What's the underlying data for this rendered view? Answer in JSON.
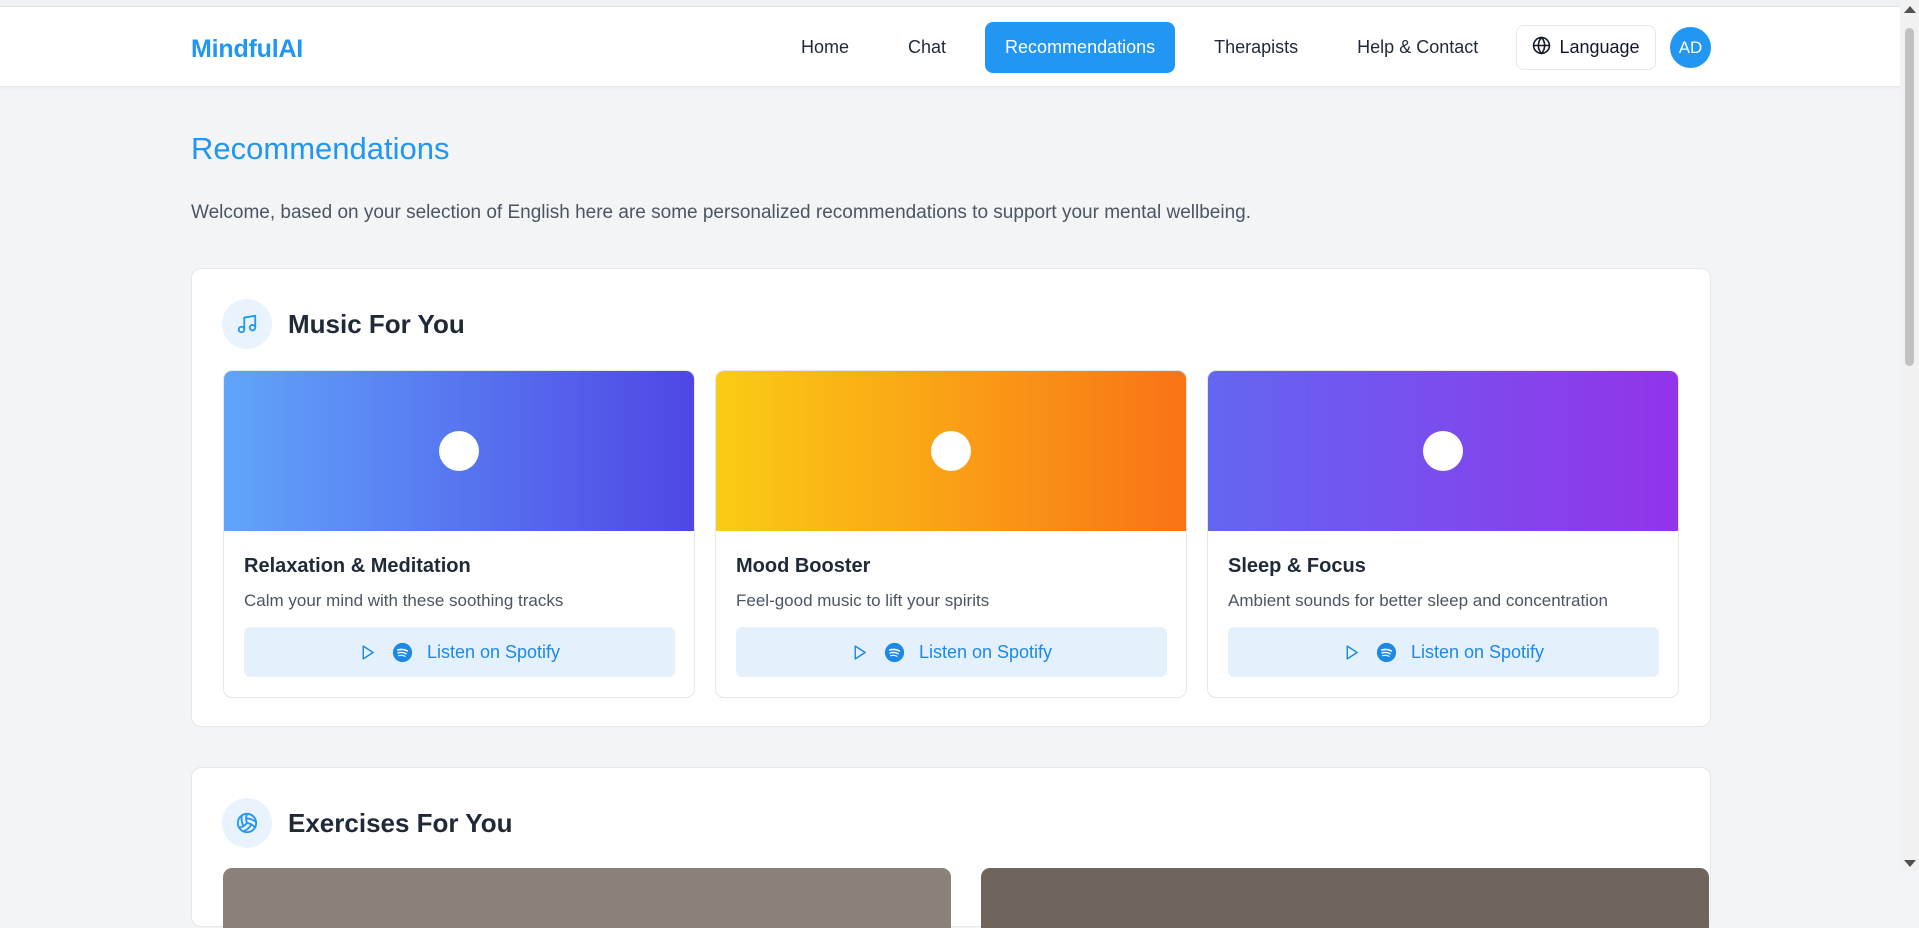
{
  "app": {
    "brand": "MindfulAI",
    "nav": [
      {
        "label": "Home",
        "active": false
      },
      {
        "label": "Chat",
        "active": false
      },
      {
        "label": "Recommendations",
        "active": true
      },
      {
        "label": "Therapists",
        "active": false
      },
      {
        "label": "Help & Contact",
        "active": false
      }
    ],
    "language_label": "Language",
    "avatar_initials": "AD",
    "accent_color": "#2196f3"
  },
  "page": {
    "title": "Recommendations",
    "intro": "Welcome, based on your selection of English here are some personalized recommendations to support your mental wellbeing."
  },
  "music": {
    "section_title": "Music For You",
    "section_icon": "music-note-icon",
    "cards": [
      {
        "title": "Relaxation & Meditation",
        "description": "Calm your mind with these soothing tracks",
        "button_label": "Listen on Spotify",
        "gradient": [
          "#60a5fa",
          "#4f46e5"
        ]
      },
      {
        "title": "Mood Booster",
        "description": "Feel-good music to lift your spirits",
        "button_label": "Listen on Spotify",
        "gradient": [
          "#facc15",
          "#f97316"
        ]
      },
      {
        "title": "Sleep & Focus",
        "description": "Ambient sounds for better sleep and concentration",
        "button_label": "Listen on Spotify",
        "gradient": [
          "#6366f1",
          "#9333ea"
        ]
      }
    ]
  },
  "exercises": {
    "section_title": "Exercises For You",
    "section_icon": "volleyball-icon"
  }
}
